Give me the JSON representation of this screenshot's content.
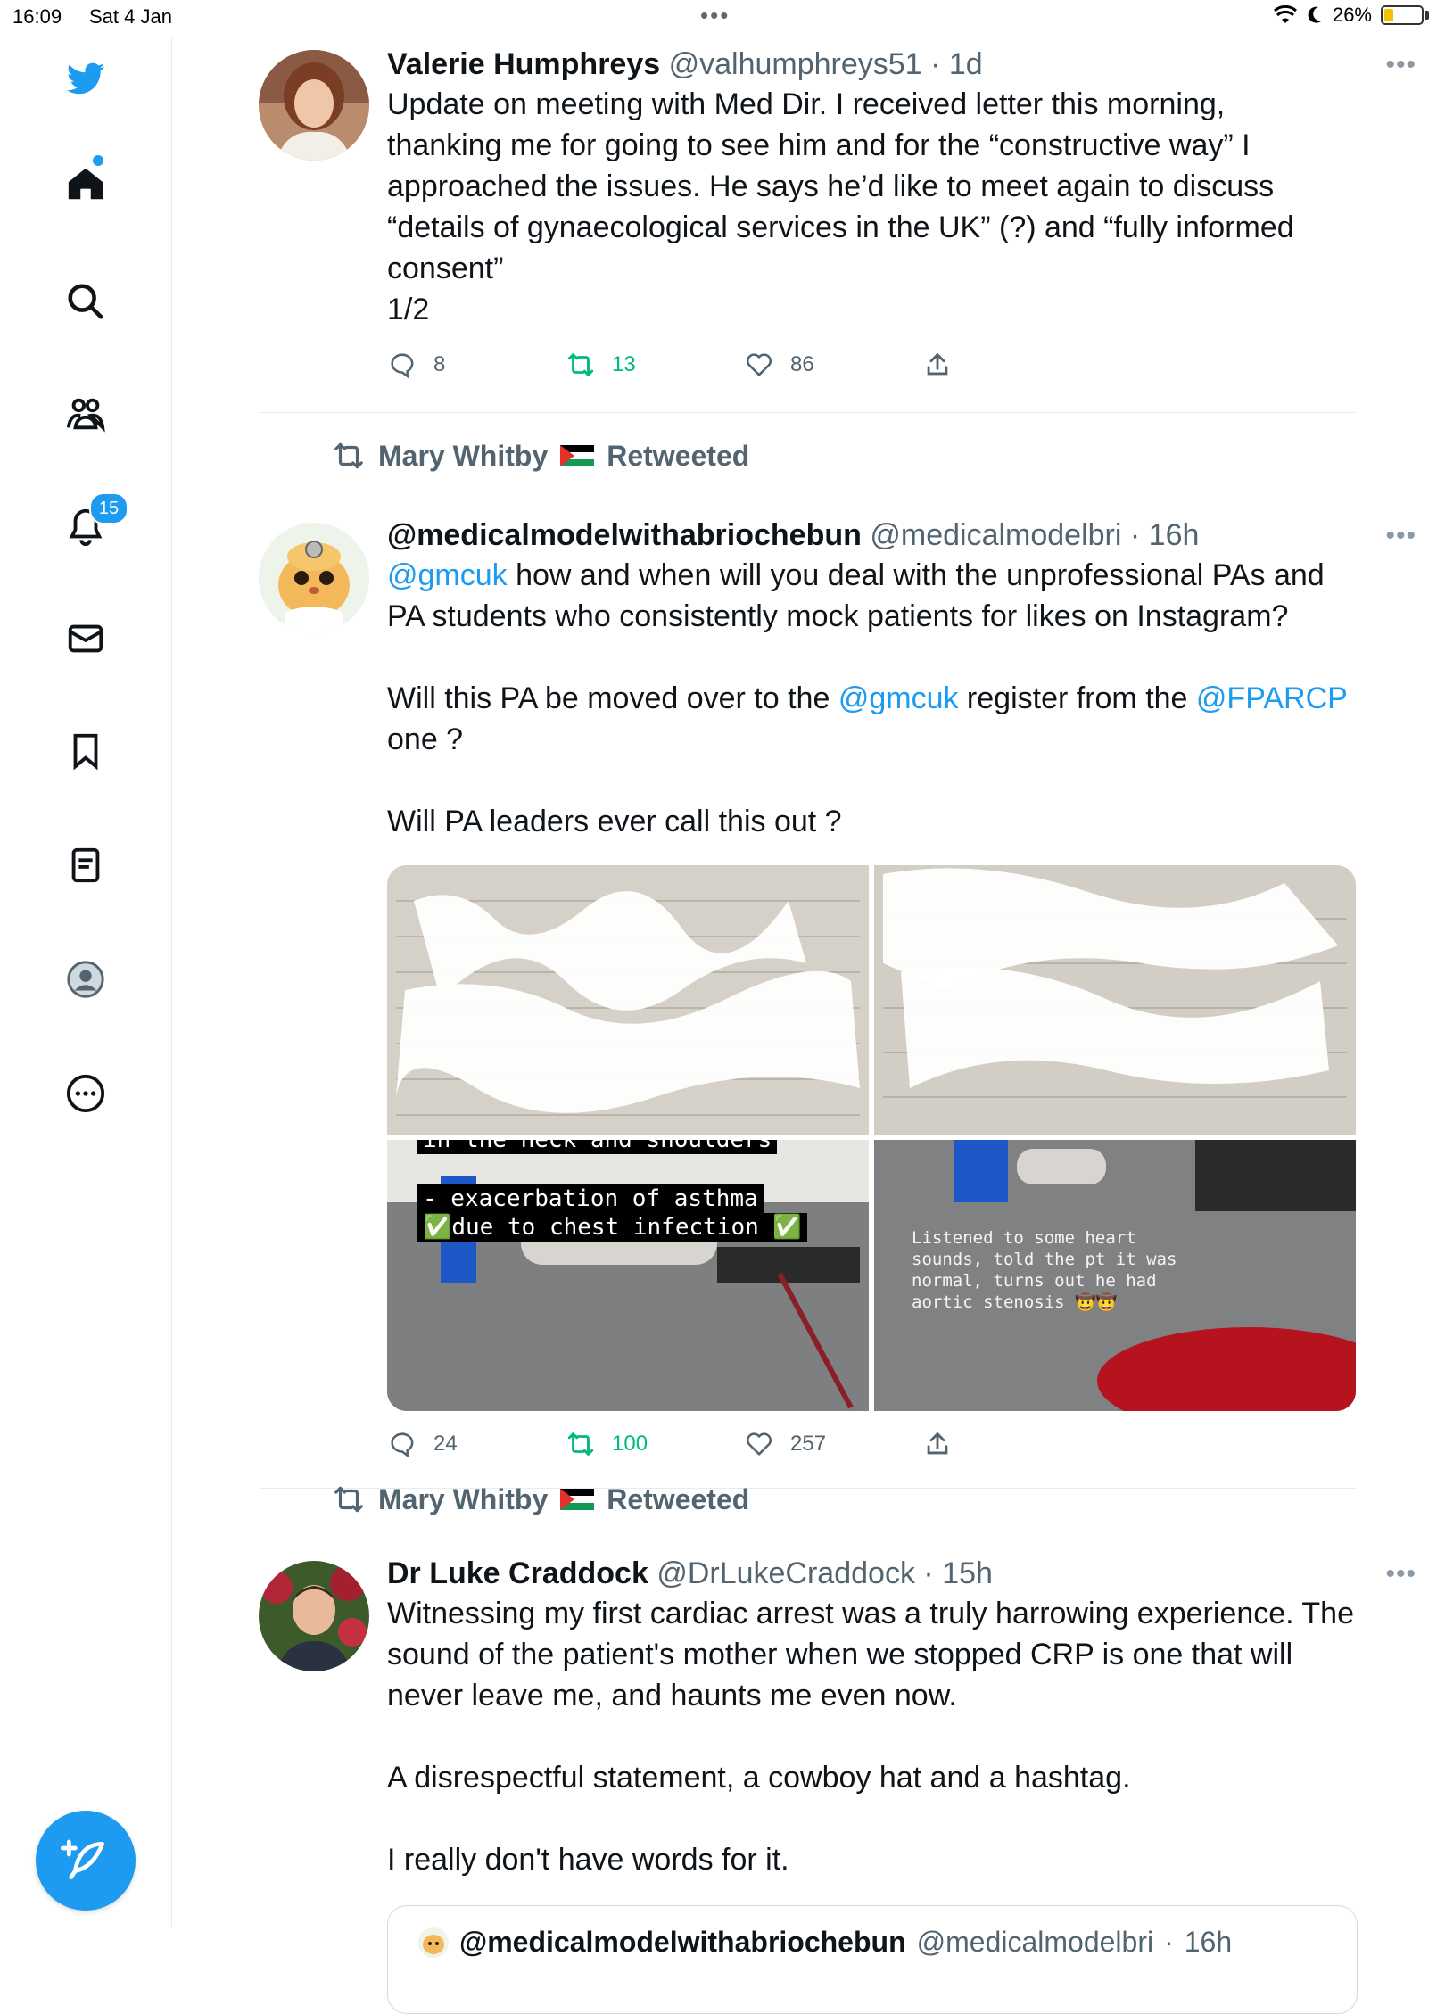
{
  "status_bar": {
    "time": "16:09",
    "date": "Sat 4 Jan",
    "battery": "26%",
    "battery_level": 0.26
  },
  "sidebar": {
    "items": [
      {
        "name": "home",
        "label": "Home"
      },
      {
        "name": "explore",
        "label": "Search"
      },
      {
        "name": "communities",
        "label": "Communities"
      },
      {
        "name": "notifications",
        "label": "Notifications",
        "badge": "15"
      },
      {
        "name": "messages",
        "label": "Messages"
      },
      {
        "name": "bookmarks",
        "label": "Bookmarks"
      },
      {
        "name": "lists",
        "label": "Lists"
      },
      {
        "name": "profile",
        "label": "Profile"
      },
      {
        "name": "more",
        "label": "More"
      }
    ]
  },
  "tweets": [
    {
      "name": "Valerie Humphreys",
      "handle": "@valhumphreys51",
      "sep": "·",
      "time": "1d",
      "text": [
        "Update on meeting with Med Dir. I received letter this morning,",
        "thanking me for going to see him and for the “constructive way” I",
        "approached the issues. He says he’d like to meet again to discuss",
        "“details of gynaecological services in the UK” (?) and “fully informed",
        "consent”",
        "1/2"
      ],
      "replies": "8",
      "retweets": "13",
      "likes": "86"
    },
    {
      "retweeted_by": "Mary Whitby",
      "retweeted_label": "Retweeted",
      "name": "@medicalmodelwithabriochebun",
      "handle": "@medicalmodelbri",
      "sep": "·",
      "time": "16h",
      "p1_mention": "@gmcuk",
      "p1_rest": " how and when will you deal with the unprofessional PAs and",
      "p1_line2": "PA students who consistently mock patients for likes on Instagram?",
      "p2_a": "Will this PA be moved over to the ",
      "p2_mention1": "@gmcuk",
      "p2_b": " register from the ",
      "p2_mention2": "@FPARCP",
      "p2_line2": "one ?",
      "p3": "Will PA leaders ever call this out ?",
      "media": {
        "caption_top": "in the neck and shoulders",
        "caption_1": "- exacerbation of asthma",
        "caption_2": "✅due to chest infection ✅",
        "caption_right": "Listened to some heart\nsounds, told the pt it was\nnormal, turns out he had\naortic stenosis 🤠🤠"
      },
      "replies": "24",
      "retweets": "100",
      "likes": "257"
    },
    {
      "retweeted_by": "Mary Whitby",
      "retweeted_label": "Retweeted",
      "name": "Dr Luke Craddock",
      "handle": "@DrLukeCraddock",
      "sep": "·",
      "time": "15h",
      "p1": [
        "Witnessing my first cardiac arrest was a truly harrowing experience. The",
        "sound of the patient's mother when we stopped CRP is one that will",
        "never leave me, and haunts me even now."
      ],
      "p2": "A disrespectful statement, a cowboy hat and a hashtag.",
      "p3": "I really don't have words for it.",
      "quote": {
        "name": "@medicalmodelwithabriochebun",
        "handle": "@medicalmodelbri",
        "sep": "·",
        "time": "16h"
      }
    }
  ],
  "colors": {
    "accent": "#1d9bf0",
    "retweet": "#00ba7c",
    "muted": "#536471"
  }
}
